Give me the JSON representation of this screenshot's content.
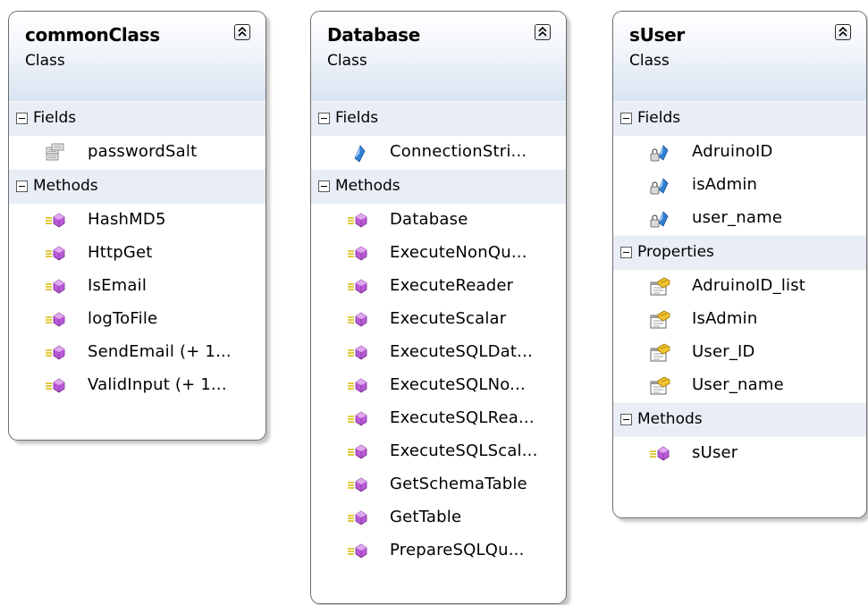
{
  "classes": [
    {
      "name": "commonClass",
      "stereotype": "Class",
      "sections": [
        {
          "label": "Fields",
          "members": [
            {
              "label": "passwordSalt",
              "icon": "private-field-icon"
            }
          ]
        },
        {
          "label": "Methods",
          "members": [
            {
              "label": "HashMD5",
              "icon": "method-icon"
            },
            {
              "label": "HttpGet",
              "icon": "method-icon"
            },
            {
              "label": "IsEmail",
              "icon": "method-icon"
            },
            {
              "label": "logToFile",
              "icon": "method-icon"
            },
            {
              "label": "SendEmail (+ 1...",
              "icon": "method-icon"
            },
            {
              "label": "ValidInput (+ 1...",
              "icon": "method-icon"
            }
          ]
        }
      ]
    },
    {
      "name": "Database",
      "stereotype": "Class",
      "sections": [
        {
          "label": "Fields",
          "members": [
            {
              "label": "ConnectionStri...",
              "icon": "field-icon"
            }
          ]
        },
        {
          "label": "Methods",
          "members": [
            {
              "label": "Database",
              "icon": "method-icon"
            },
            {
              "label": "ExecuteNonQu...",
              "icon": "method-icon"
            },
            {
              "label": "ExecuteReader",
              "icon": "method-icon"
            },
            {
              "label": "ExecuteScalar",
              "icon": "method-icon"
            },
            {
              "label": "ExecuteSQLDat...",
              "icon": "method-icon"
            },
            {
              "label": "ExecuteSQLNo...",
              "icon": "method-icon"
            },
            {
              "label": "ExecuteSQLRea...",
              "icon": "method-icon"
            },
            {
              "label": "ExecuteSQLScal...",
              "icon": "method-icon"
            },
            {
              "label": "GetSchemaTable",
              "icon": "method-icon"
            },
            {
              "label": "GetTable",
              "icon": "method-icon"
            },
            {
              "label": "PrepareSQLQu...",
              "icon": "method-icon"
            }
          ]
        }
      ]
    },
    {
      "name": "sUser",
      "stereotype": "Class",
      "sections": [
        {
          "label": "Fields",
          "members": [
            {
              "label": "AdruinoID",
              "icon": "private-field-icon"
            },
            {
              "label": "isAdmin",
              "icon": "private-field-icon"
            },
            {
              "label": "user_name",
              "icon": "private-field-icon"
            }
          ]
        },
        {
          "label": "Properties",
          "members": [
            {
              "label": "AdruinoID_list",
              "icon": "property-icon"
            },
            {
              "label": "IsAdmin",
              "icon": "property-icon"
            },
            {
              "label": "User_ID",
              "icon": "property-icon"
            },
            {
              "label": "User_name",
              "icon": "property-icon"
            }
          ]
        },
        {
          "label": "Methods",
          "members": [
            {
              "label": "sUser",
              "icon": "method-icon"
            }
          ]
        }
      ]
    }
  ]
}
